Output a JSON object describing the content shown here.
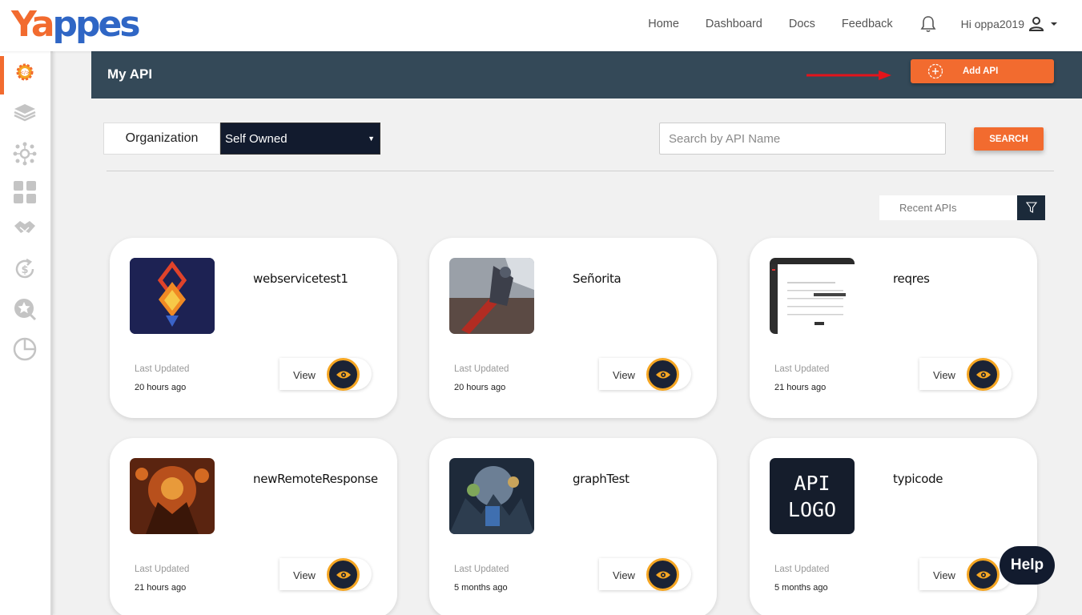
{
  "brand": {
    "part1": "Ya",
    "part2": "ppes"
  },
  "nav": {
    "links": [
      "Home",
      "Dashboard",
      "Docs",
      "Feedback"
    ],
    "greeting": "Hi oppa2019"
  },
  "sidebar": {
    "items": [
      "api-gear-icon",
      "layers-icon",
      "network-icon",
      "grid-icon",
      "handshake-icon",
      "dollar-refresh-icon",
      "star-search-icon",
      "pie-chart-icon"
    ]
  },
  "header": {
    "title": "My API",
    "add_label": "Add API"
  },
  "filters": {
    "org_label": "Organization",
    "org_value": "Self Owned",
    "search_placeholder": "Search by API Name",
    "search_label": "SEARCH",
    "sort_value": "Recent APIs"
  },
  "cards": [
    {
      "name": "webservicetest1",
      "updated_label": "Last Updated",
      "updated": "20 hours ago",
      "view": "View"
    },
    {
      "name": "Señorita",
      "updated_label": "Last Updated",
      "updated": "20 hours ago",
      "view": "View"
    },
    {
      "name": "reqres",
      "updated_label": "Last Updated",
      "updated": "21 hours ago",
      "view": "View"
    },
    {
      "name": "newRemoteResponse",
      "updated_label": "Last Updated",
      "updated": "21 hours ago",
      "view": "View"
    },
    {
      "name": "graphTest",
      "updated_label": "Last Updated",
      "updated": "5 months ago",
      "view": "View"
    },
    {
      "name": "typicode",
      "updated_label": "Last Updated",
      "updated": "5 months ago",
      "view": "View",
      "logo_line1": "API",
      "logo_line2": "LOGO"
    }
  ],
  "help_label": "Help",
  "colors": {
    "accent": "#f26b2f",
    "band": "#344958",
    "dark": "#121b2e",
    "eye_ring": "#f5a623"
  }
}
